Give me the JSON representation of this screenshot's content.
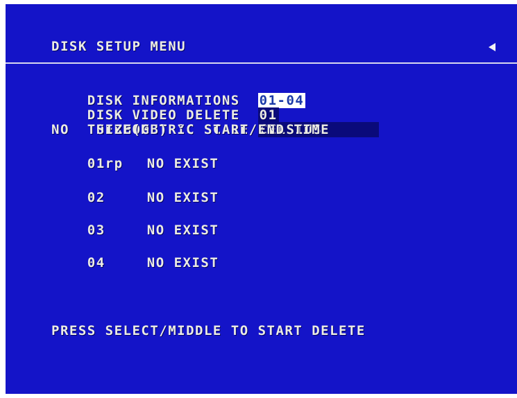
{
  "header": {
    "title": "DISK SETUP MENU",
    "back_icon": "back-arrow-icon"
  },
  "settings": {
    "disk_info_label": "DISK INFORMATIONS",
    "disk_info_value": "01-04",
    "video_delete_label": "DISK VIDEO DELETE",
    "video_delete_value": "01",
    "scale_label": "THERMOMETRIC SCALE",
    "scale_value": "CELSIUS"
  },
  "table": {
    "header": "NO   SIZE(GB) °C START/END TIME",
    "rows": [
      {
        "no": "01rp",
        "status": "NO EXIST"
      },
      {
        "no": "02",
        "status": "NO EXIST"
      },
      {
        "no": "03",
        "status": "NO EXIST"
      },
      {
        "no": "04",
        "status": "NO EXIST"
      }
    ]
  },
  "footer": {
    "message": "PRESS SELECT/MIDDLE TO START DELETE"
  },
  "colors": {
    "background": "#1414c8",
    "text": "#ecece4",
    "highlight": "#ffffff",
    "field_bg": "#0a0a7a"
  }
}
